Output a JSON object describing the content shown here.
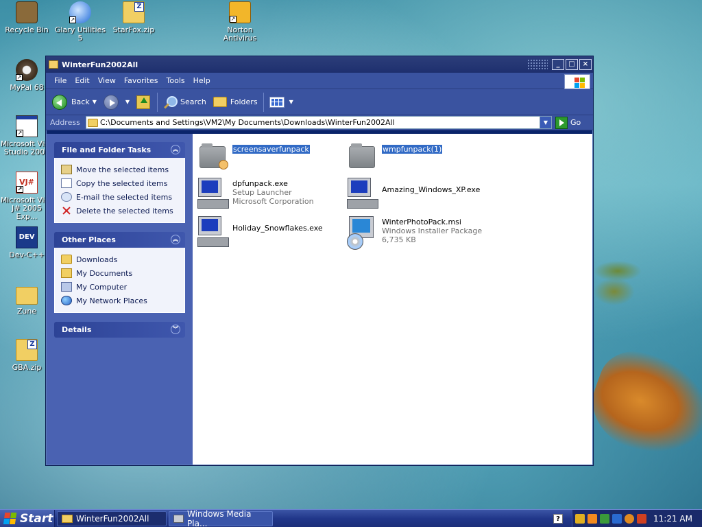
{
  "desktop": {
    "icons": [
      {
        "label": "Recycle Bin"
      },
      {
        "label": "Glary Utilities 5"
      },
      {
        "label": "StarFox.zip"
      },
      {
        "label": "Norton Antivirus"
      },
      {
        "label": "MyPal 68"
      },
      {
        "label": "Microsoft Visu Studio 2005"
      },
      {
        "label": "Microsoft Visu J# 2005 Exp..."
      },
      {
        "label": "Dev-C++"
      },
      {
        "label": "Zune"
      },
      {
        "label": "GBA.zip"
      }
    ]
  },
  "window": {
    "title": "WinterFun2002All",
    "controls": {
      "minimize": "_",
      "maximize": "□",
      "close": "×"
    },
    "menu": [
      "File",
      "Edit",
      "View",
      "Favorites",
      "Tools",
      "Help"
    ],
    "toolbar": {
      "back_label": "Back",
      "search_label": "Search",
      "folders_label": "Folders"
    },
    "address": {
      "label": "Address",
      "value": "C:\\Documents and Settings\\VM2\\My Documents\\Downloads\\WinterFun2002All",
      "go_label": "Go"
    },
    "tasks_panel": {
      "title": "File and Folder Tasks",
      "items": [
        {
          "label": "Move the selected items",
          "icon": "move-icon"
        },
        {
          "label": "Copy the selected items",
          "icon": "copy-icon"
        },
        {
          "label": "E-mail the selected items",
          "icon": "email-icon"
        },
        {
          "label": "Delete the selected items",
          "icon": "delete-icon"
        }
      ]
    },
    "places_panel": {
      "title": "Other Places",
      "items": [
        {
          "label": "Downloads",
          "icon": "folder-icon"
        },
        {
          "label": "My Documents",
          "icon": "documents-icon"
        },
        {
          "label": "My Computer",
          "icon": "computer-icon"
        },
        {
          "label": "My Network Places",
          "icon": "network-icon"
        }
      ]
    },
    "details_panel": {
      "title": "Details"
    },
    "files": [
      {
        "name": "screensaverfunpack",
        "type": "folder",
        "selected": true,
        "line2": "",
        "line3": ""
      },
      {
        "name": "wmpfunpack(1)",
        "type": "folder",
        "selected": true,
        "line2": "",
        "line3": ""
      },
      {
        "name": "dpfunpack.exe",
        "type": "setup",
        "selected": false,
        "line2": "Setup Launcher",
        "line3": "Microsoft Corporation"
      },
      {
        "name": "Amazing_Windows_XP.exe",
        "type": "setup",
        "selected": false,
        "line2": "",
        "line3": ""
      },
      {
        "name": "Holiday_Snowflakes.exe",
        "type": "setup",
        "selected": false,
        "line2": "",
        "line3": ""
      },
      {
        "name": "WinterPhotoPack.msi",
        "type": "msi",
        "selected": false,
        "line2": "Windows Installer Package",
        "line3": "6,735 KB"
      }
    ]
  },
  "taskbar": {
    "start_label": "Start",
    "tasks": [
      {
        "label": "WinterFun2002All",
        "active": true
      },
      {
        "label": "Windows Media Pla...",
        "active": false
      }
    ],
    "help_label": "?",
    "clock": "11:21 AM"
  }
}
